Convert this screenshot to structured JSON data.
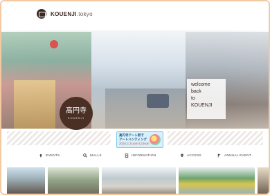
{
  "header": {
    "site_name": "KOUENJI",
    "site_suffix": ".tokyo"
  },
  "hero": {
    "welcome_lines": [
      "welcome",
      "back",
      "to",
      "KOUENJI"
    ],
    "badge_title": "高円寺",
    "badge_romaji": "KOUENJI"
  },
  "banner": {
    "line1": "高円寺アート街で",
    "line2": "アートハンティング",
    "dates": "2015.2.21sat-3.22sun"
  },
  "nav": {
    "items": [
      {
        "label": "EVENTS",
        "icon": "pin-icon"
      },
      {
        "label": "MALLS",
        "icon": "search-icon"
      },
      {
        "label": "INFORMATION",
        "icon": "document-icon"
      },
      {
        "label": "ACCESS",
        "icon": "location-icon"
      },
      {
        "label": "ANNUAL EVENT",
        "icon": "flag-icon"
      }
    ]
  },
  "colors": {
    "brand_brown": "#4a2f25",
    "frame_peach": "#f3c9a2",
    "banner_blue": "#7fc8e8"
  }
}
